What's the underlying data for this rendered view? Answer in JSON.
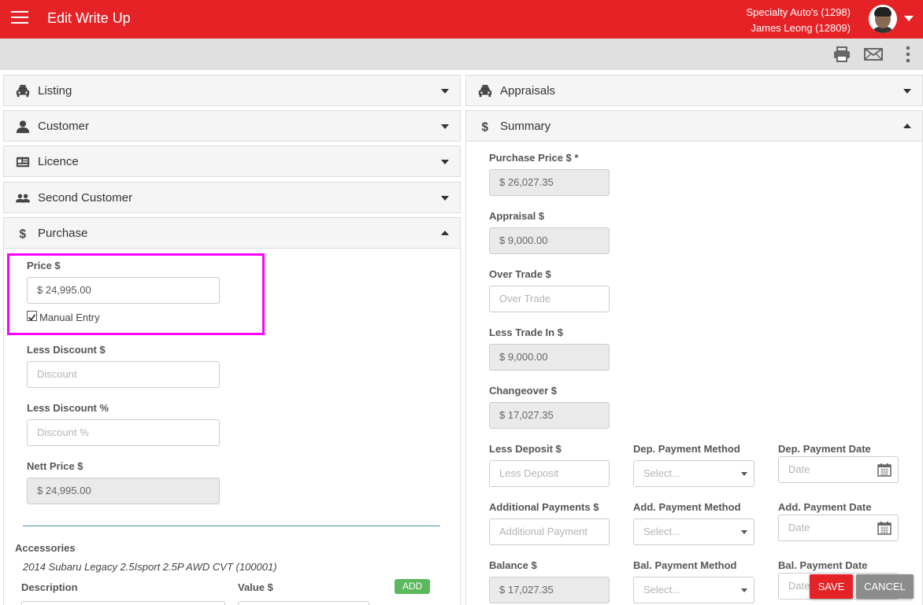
{
  "header": {
    "title": "Edit Write Up",
    "dealer": "Specialty Auto's (1298)",
    "user": "James Leong (12809)"
  },
  "colors": {
    "brand": "#e52327",
    "highlight": "#ff00ff",
    "add_button": "#5cb85c"
  },
  "toolbar": {
    "icons": [
      "print-icon",
      "email-icon",
      "more-vert-icon"
    ]
  },
  "left_panels": [
    {
      "label": "Listing",
      "icon": "car-icon",
      "expanded": false
    },
    {
      "label": "Customer",
      "icon": "person-icon",
      "expanded": false
    },
    {
      "label": "Licence",
      "icon": "id-card-icon",
      "expanded": false
    },
    {
      "label": "Second Customer",
      "icon": "people-icon",
      "expanded": false
    },
    {
      "label": "Purchase",
      "icon": "dollar-icon",
      "expanded": true
    }
  ],
  "right_panels": [
    {
      "label": "Appraisals",
      "icon": "car-icon",
      "expanded": false
    },
    {
      "label": "Summary",
      "icon": "dollar-icon",
      "expanded": true
    }
  ],
  "purchase": {
    "price_label": "Price $",
    "price_value": "$ 24,995.00",
    "manual_entry_label": "Manual Entry",
    "manual_entry_checked": true,
    "less_discount_label": "Less Discount $",
    "less_discount_placeholder": "Discount",
    "less_discount_pct_label": "Less Discount %",
    "less_discount_pct_placeholder": "Discount %",
    "nett_price_label": "Nett Price $",
    "nett_price_value": "$ 24,995.00"
  },
  "accessories": {
    "heading": "Accessories",
    "vehicle": "2014 Subaru Legacy 2.5Isport 2.5P AWD CVT (100001)",
    "description_label": "Description",
    "value_label": "Value $",
    "add_label": "ADD"
  },
  "summary": {
    "purchase_price_label": "Purchase Price $ *",
    "purchase_price_value": "$ 26,027.35",
    "appraisal_label": "Appraisal $",
    "appraisal_value": "$ 9,000.00",
    "over_trade_label": "Over Trade $",
    "over_trade_placeholder": "Over Trade",
    "less_trade_in_label": "Less Trade In $",
    "less_trade_in_value": "$ 9,000.00",
    "changeover_label": "Changeover $",
    "changeover_value": "$ 17,027.35",
    "less_deposit_label": "Less Deposit $",
    "less_deposit_placeholder": "Less Deposit",
    "dep_method_label": "Dep. Payment Method",
    "dep_method_placeholder": "Select...",
    "dep_date_label": "Dep. Payment Date",
    "dep_date_placeholder": "Date",
    "additional_payments_label": "Additional Payments $",
    "additional_payment_placeholder": "Additional Payment",
    "add_method_label": "Add. Payment Method",
    "add_method_placeholder": "Select...",
    "add_date_label": "Add. Payment Date",
    "add_date_placeholder": "Date",
    "balance_label": "Balance $",
    "balance_value": "$ 17,027.35",
    "bal_method_label": "Bal. Payment Method",
    "bal_method_placeholder": "Select...",
    "bal_date_label": "Bal. Payment Date",
    "bal_date_placeholder": "Date"
  },
  "actions": {
    "save": "SAVE",
    "cancel": "CANCEL"
  }
}
